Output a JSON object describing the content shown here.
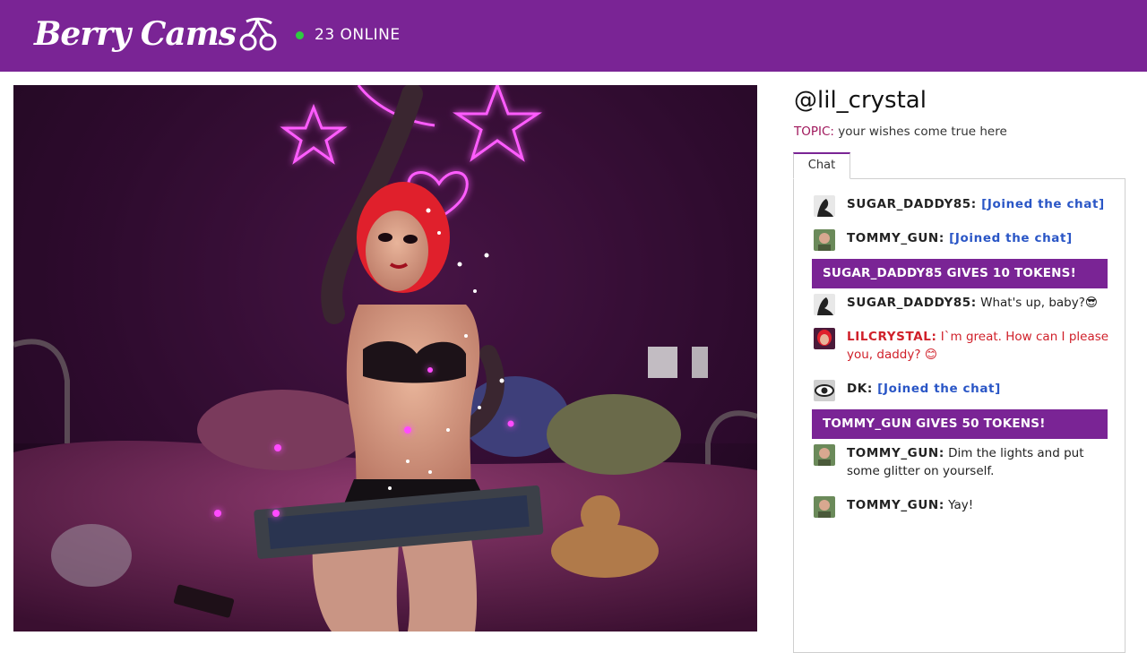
{
  "header": {
    "logo_text": "Berry Cams",
    "online_label": "23 ONLINE",
    "online_dot_color": "#2ecc40",
    "brand_color": "#7a2495"
  },
  "room": {
    "username": "@lil_crystal",
    "topic_label": "TOPIC:",
    "topic_text": " your wishes come true here"
  },
  "tabs": [
    {
      "label": "Chat",
      "active": true
    }
  ],
  "chat": {
    "messages": [
      {
        "type": "message",
        "user": "SUGAR_DADDY85:",
        "text": " [Joined the chat]",
        "style": "joined",
        "avatar": "silhouette-avatar"
      },
      {
        "type": "message",
        "user": "TOMMY_GUN:",
        "text": " [Joined the chat]",
        "style": "joined",
        "avatar": "man-avatar"
      },
      {
        "type": "tip",
        "text": "SUGAR_DADDY85 GIVES 10 TOKENS!"
      },
      {
        "type": "message",
        "user": "SUGAR_DADDY85:",
        "text": " What's up, baby?😎",
        "style": "normal",
        "avatar": "silhouette-avatar"
      },
      {
        "type": "message",
        "user": "LILCRYSTAL:",
        "text": " I`m great. How can I please you, daddy? 😊",
        "style": "model",
        "avatar": "model-avatar"
      },
      {
        "type": "message",
        "user": "DK:",
        "text": " [Joined the chat]",
        "style": "joined",
        "avatar": "eye-avatar"
      },
      {
        "type": "tip",
        "text": "TOMMY_GUN GIVES 50 TOKENS!"
      },
      {
        "type": "message",
        "user": "TOMMY_GUN:",
        "text": " Dim the lights and put some glitter on yourself.",
        "style": "normal",
        "avatar": "man-avatar"
      },
      {
        "type": "message",
        "user": "TOMMY_GUN:",
        "text": " Yay!",
        "style": "normal",
        "avatar": "man-avatar"
      }
    ]
  }
}
